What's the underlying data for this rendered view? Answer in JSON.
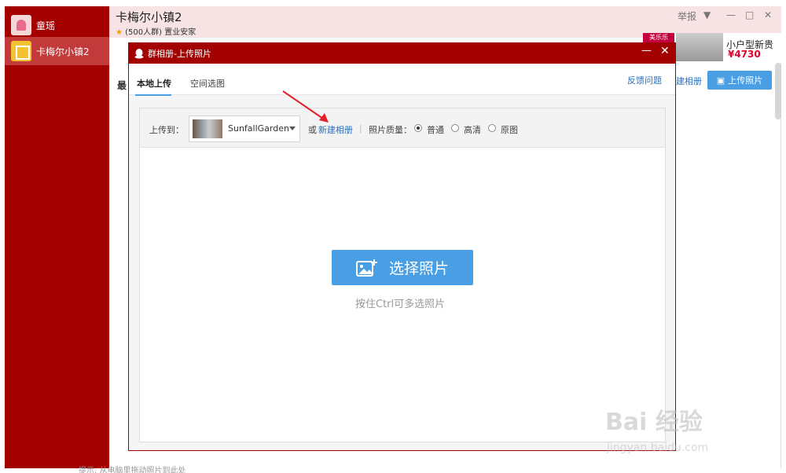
{
  "sidebar": {
    "items": [
      {
        "label": "童瑶"
      },
      {
        "label": "卡梅尔小镇2"
      }
    ]
  },
  "group": {
    "title": "卡梅尔小镇2",
    "subtitle": "(500人群) 置业安家",
    "report_label": "举报"
  },
  "ad": {
    "tag": "美乐乐",
    "title": "小户型新贵",
    "price": "¥4730"
  },
  "background_page": {
    "tab_partial": "最",
    "link_partial": "建相册",
    "upload_label": "上传照片",
    "bottom_note": "提示: 从电脑里拖动照片到此处"
  },
  "dialog": {
    "title": "群相册-上传照片",
    "tabs": [
      {
        "label": "本地上传",
        "active": true
      },
      {
        "label": "空间选图",
        "active": false
      }
    ],
    "feedback_label": "反馈问题",
    "upload_to_label": "上传到：",
    "album_name": "SunfallGarden",
    "or_label": "或",
    "new_album_label": "新建相册",
    "separator": "|",
    "quality_label": "照片质量：",
    "quality_options": [
      {
        "label": "普通",
        "selected": true
      },
      {
        "label": "高清",
        "selected": false
      },
      {
        "label": "原图",
        "selected": false
      }
    ],
    "choose_button_label": "选择照片",
    "hint_text": "按住Ctrl可多选照片"
  },
  "watermark": {
    "brand": "Bai 经验",
    "url": "jingyan.baidu.com"
  },
  "colors": {
    "sidebar": "#a30000",
    "accent_blue": "#4a9ee3",
    "link_blue": "#2a6fb8"
  }
}
